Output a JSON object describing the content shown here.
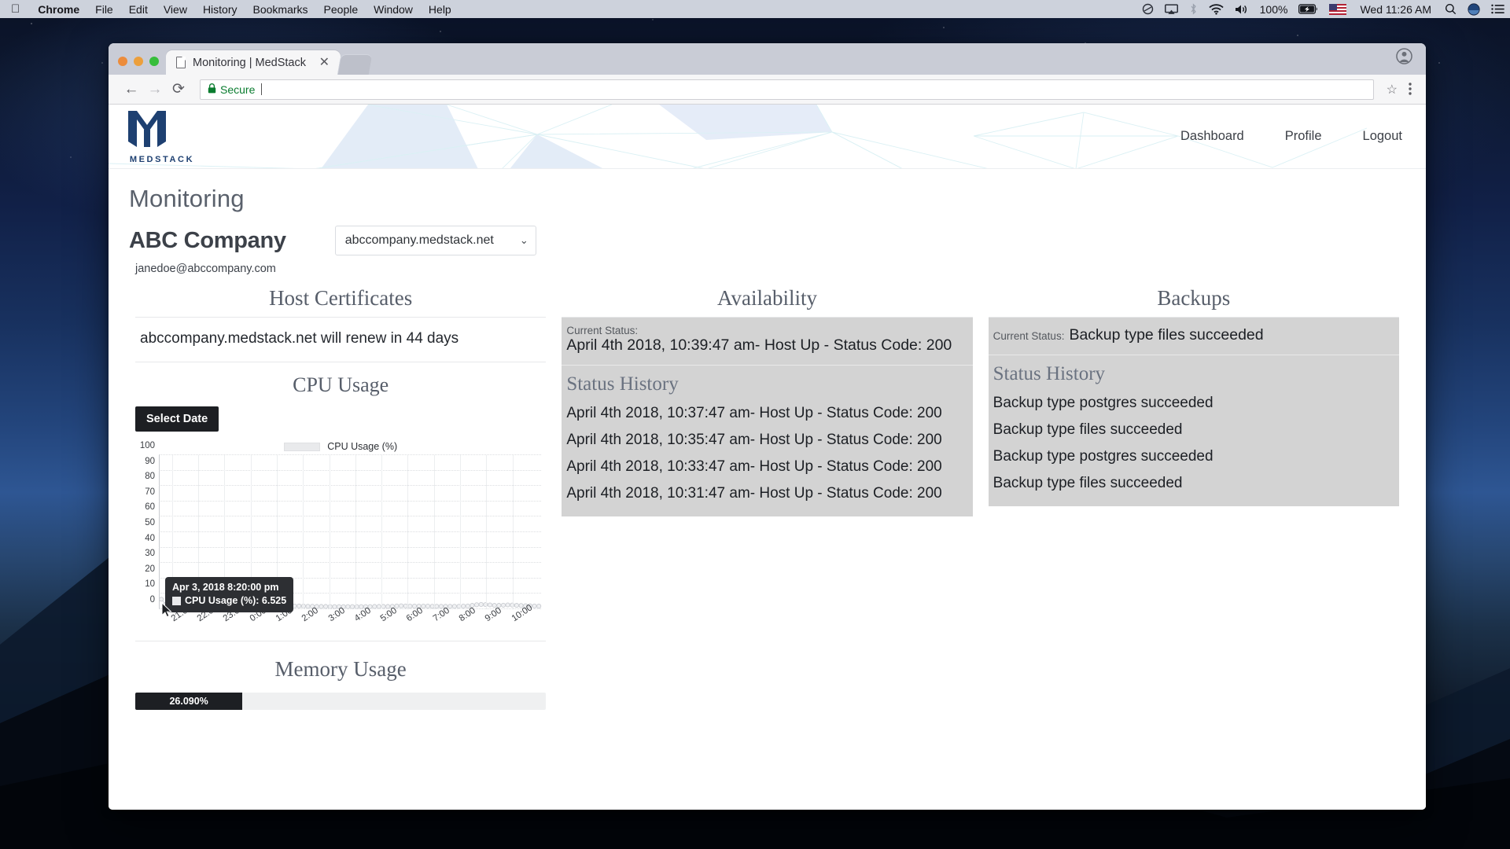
{
  "menubar": {
    "apple": "",
    "items": [
      {
        "label": "Chrome",
        "bold": true
      },
      {
        "label": "File",
        "bold": false
      },
      {
        "label": "Edit",
        "bold": false
      },
      {
        "label": "View",
        "bold": false
      },
      {
        "label": "History",
        "bold": false
      },
      {
        "label": "Bookmarks",
        "bold": false
      },
      {
        "label": "People",
        "bold": false
      },
      {
        "label": "Window",
        "bold": false
      },
      {
        "label": "Help",
        "bold": false
      }
    ],
    "battery_percent": "100%",
    "clock": "Wed 11:26 AM",
    "flag": "🇺🇸"
  },
  "browser": {
    "tab_title": "Monitoring | MedStack",
    "tab_close": "✕",
    "security_label": "Secure",
    "omnibox_value": "",
    "back": "←",
    "forward": "→",
    "reload": "⟳",
    "star": "☆",
    "menu": "⋮"
  },
  "site": {
    "logo_word": "MEDSTACK",
    "nav": [
      {
        "label": "Dashboard"
      },
      {
        "label": "Profile"
      },
      {
        "label": "Logout"
      }
    ]
  },
  "main": {
    "page_title": "Monitoring",
    "company": "ABC Company",
    "host_select_value": "abccompany.medstack.net",
    "host_select_chevron": "⌄",
    "email": "janedoe@abccompany.com"
  },
  "certificates": {
    "heading": "Host Certificates",
    "line": "abccompany.medstack.net will renew in 44 days"
  },
  "cpu": {
    "heading": "CPU Usage",
    "select_date_label": "Select Date"
  },
  "memory": {
    "heading": "Memory Usage",
    "value_label": "26.090%",
    "percent": 26.09
  },
  "availability": {
    "heading": "Availability",
    "current_status_label": "Current Status:",
    "current_status_value": "April 4th 2018, 10:39:47 am- Host Up - Status Code: 200",
    "history_heading": "Status History",
    "history": [
      "April 4th 2018, 10:37:47 am- Host Up - Status Code: 200",
      "April 4th 2018, 10:35:47 am- Host Up - Status Code: 200",
      "April 4th 2018, 10:33:47 am- Host Up - Status Code: 200",
      "April 4th 2018, 10:31:47 am- Host Up - Status Code: 200"
    ]
  },
  "backups": {
    "heading": "Backups",
    "current_status_label": "Current Status:",
    "current_status_value": "Backup type files succeeded",
    "history_heading": "Status History",
    "history": [
      "Backup type postgres succeeded",
      "Backup type files succeeded",
      "Backup type postgres succeeded",
      "Backup type files succeeded"
    ]
  },
  "chart_data": {
    "type": "line",
    "title": "CPU Usage",
    "xlabel": "",
    "ylabel": "CPU Usage (%)",
    "legend": [
      "CPU Usage (%)"
    ],
    "legend_position": "top-center",
    "grid": true,
    "ylim": [
      0,
      100
    ],
    "yticks": [
      0,
      10,
      20,
      30,
      40,
      50,
      60,
      70,
      80,
      90,
      100
    ],
    "xticks": [
      "21:00",
      "22:00",
      "23:00",
      "0:00",
      "1:00",
      "2:00",
      "3:00",
      "4:00",
      "5:00",
      "6:00",
      "7:00",
      "8:00",
      "9:00",
      "10:00"
    ],
    "series": [
      {
        "name": "CPU Usage (%)",
        "x": [
          "20:20",
          "20:30",
          "20:40",
          "20:50",
          "21:00",
          "21:10",
          "21:20",
          "21:30",
          "21:40",
          "21:50",
          "22:00",
          "22:10",
          "22:20",
          "22:30",
          "22:40",
          "22:50",
          "23:00",
          "23:10",
          "23:20",
          "23:30",
          "23:40",
          "23:50",
          "0:00",
          "0:10",
          "0:20",
          "0:30",
          "0:40",
          "0:50",
          "1:00",
          "1:10",
          "1:20",
          "1:30",
          "1:40",
          "1:50",
          "2:00",
          "2:10",
          "2:20",
          "2:30",
          "2:40",
          "2:50",
          "3:00",
          "3:10",
          "3:20",
          "3:30",
          "3:40",
          "3:50",
          "4:00",
          "4:10",
          "4:20",
          "4:30",
          "4:40",
          "4:50",
          "5:00",
          "5:10",
          "5:20",
          "5:30",
          "5:40",
          "5:50",
          "6:00",
          "6:10",
          "6:20",
          "6:30",
          "6:40",
          "6:50",
          "7:00",
          "7:10",
          "7:20",
          "7:30",
          "7:40",
          "7:50",
          "8:00",
          "8:10",
          "8:20",
          "8:30",
          "8:40",
          "8:50",
          "9:00",
          "9:10",
          "9:20",
          "9:30",
          "9:40",
          "9:50",
          "10:00",
          "10:10",
          "10:20",
          "10:30"
        ],
        "values": [
          6.5,
          3.2,
          2.0,
          1.6,
          1.5,
          1.4,
          1.4,
          1.5,
          1.5,
          1.4,
          1.4,
          1.4,
          1.5,
          1.5,
          1.4,
          1.4,
          1.5,
          1.5,
          1.4,
          1.5,
          1.5,
          1.6,
          1.5,
          1.5,
          1.6,
          1.6,
          1.5,
          1.6,
          1.7,
          2.0,
          2.1,
          2.1,
          2.0,
          1.9,
          1.9,
          1.8,
          1.8,
          1.8,
          1.7,
          1.7,
          1.7,
          1.7,
          1.7,
          1.7,
          1.7,
          1.7,
          1.7,
          1.7,
          1.8,
          1.8,
          1.8,
          1.8,
          1.9,
          2.1,
          2.2,
          2.1,
          2.0,
          2.0,
          2.0,
          2.0,
          2.0,
          1.9,
          1.9,
          1.9,
          1.9,
          1.9,
          1.9,
          1.9,
          2.0,
          2.1,
          2.5,
          2.9,
          3.1,
          3.0,
          2.8,
          2.5,
          2.5,
          2.6,
          2.8,
          2.7,
          2.5,
          2.4,
          2.3,
          2.2,
          2.1,
          2.0
        ]
      }
    ],
    "tooltip": {
      "timestamp": "Apr 3, 2018 8:20:00 pm",
      "series_label": "CPU Usage (%): 6.525",
      "value": 6.525
    }
  }
}
